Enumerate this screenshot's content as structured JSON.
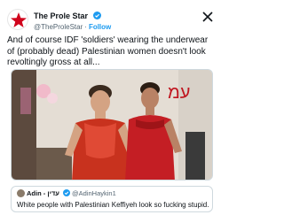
{
  "tweet": {
    "display_name": "The Prole Star",
    "handle": "@TheProleStar",
    "separator": "·",
    "follow_label": "Follow",
    "text": "And of course IDF 'soldiers' wearing the underwear of (probably dead) Palestinian women doesn't look revoltingly gross at all...",
    "verified_icon": "verified-badge-icon",
    "platform_icon": "x-logo-icon",
    "avatar_icon": "red-star-icon"
  },
  "media": {
    "graffiti_text": "עמ"
  },
  "quote": {
    "name": "Adin - עדין",
    "handle": "@AdinHaykin1",
    "text": "White people with Palestinian Keffiyeh look so fucking stupid."
  },
  "colors": {
    "accent": "#1d9bf0",
    "text": "#0f1419",
    "muted": "#536471",
    "border": "#cfd9de",
    "star": "#d0021b"
  }
}
